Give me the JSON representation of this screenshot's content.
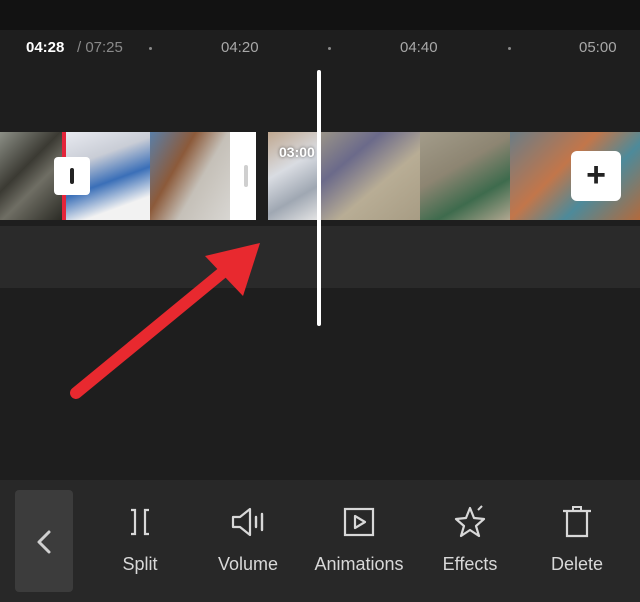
{
  "timeline": {
    "current_time": "04:28",
    "total_time": "/ 07:25",
    "ticks": [
      "04:20",
      "04:40",
      "05:00"
    ]
  },
  "track": {
    "clip_duration": "03:00",
    "add_clip_label": "+"
  },
  "toolbar": {
    "back_icon": "chevron-left-icon",
    "tools": [
      {
        "label": "Split",
        "icon": "split-icon"
      },
      {
        "label": "Volume",
        "icon": "volume-icon"
      },
      {
        "label": "Animations",
        "icon": "animations-icon"
      },
      {
        "label": "Effects",
        "icon": "effects-icon"
      },
      {
        "label": "Delete",
        "icon": "delete-icon"
      }
    ]
  },
  "colors": {
    "background": "#1e1e1e",
    "playhead": "#ffffff",
    "annotation_arrow": "#e8292f",
    "split_marker": "#e4243a"
  }
}
